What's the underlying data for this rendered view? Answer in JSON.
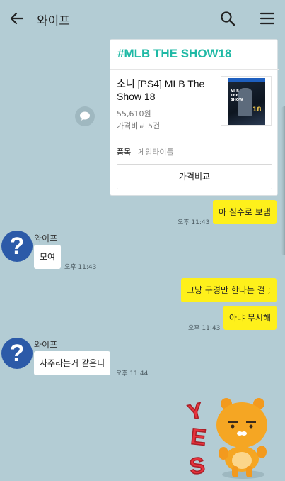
{
  "header": {
    "title": "와이프"
  },
  "card": {
    "hashtag": "#MLB THE SHOW18",
    "product_name": "소니 [PS4] MLB The Show 18",
    "price": "55,610원",
    "compare_count": "가격비교 5건",
    "category_label": "품목",
    "category_value": "게임타이틀",
    "compare_button": "가격비교"
  },
  "messages": [
    {
      "side": "me",
      "text": "아 실수로 보냄",
      "time": "오후 11:43"
    },
    {
      "side": "them",
      "sender": "와이프",
      "text": "모여",
      "time": "오후 11:43"
    },
    {
      "side": "me",
      "text": "그냥 구경만 한다는 걸 ;",
      "time": ""
    },
    {
      "side": "me",
      "text": "아냐 무시해",
      "time": "오후 11:43"
    },
    {
      "side": "them",
      "sender": "와이프",
      "text": "사주라는거 같은디",
      "time": "오후 11:44"
    }
  ],
  "avatar_glyph": "?",
  "sticker_text": "YES",
  "colors": {
    "background": "#b3ccd4",
    "my_bubble": "#fef01b",
    "their_bubble": "#ffffff",
    "hashtag": "#1fb9a5",
    "avatar": "#2c5aa8"
  }
}
